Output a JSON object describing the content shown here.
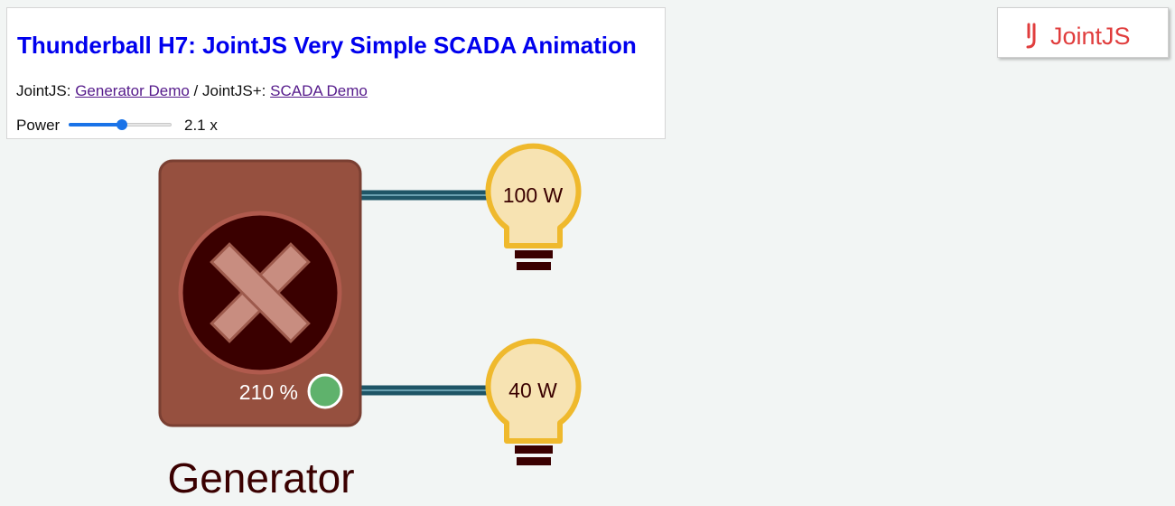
{
  "header": {
    "title": "Thunderball H7: JointJS Very Simple SCADA Animation",
    "links_prefix": "JointJS: ",
    "generator_link": "Generator Demo",
    "links_separator": " / JointJS+: ",
    "scada_link": "SCADA Demo",
    "power_label": "Power",
    "power_value": "2.1 x",
    "power_fraction": 0.52
  },
  "logo": {
    "text": "JointJS",
    "color": "#e03d3d"
  },
  "diagram": {
    "generator_label": "Generator",
    "generator_power": "210 %",
    "bulb_top_label": "100 W",
    "bulb_bottom_label": "40 W",
    "colors": {
      "generator_body": "#96503f",
      "generator_border": "#7a3f32",
      "fan_circle": "#3a0000",
      "fan_ring": "#b05a4d",
      "fan_blade": "#c88d80",
      "indicator": "#5fb26c",
      "wire": "#1f5566",
      "bulb_fill": "#f7e3b2",
      "bulb_stroke": "#efb92d",
      "bulb_base": "#3a0000",
      "label": "#3a0000"
    }
  }
}
